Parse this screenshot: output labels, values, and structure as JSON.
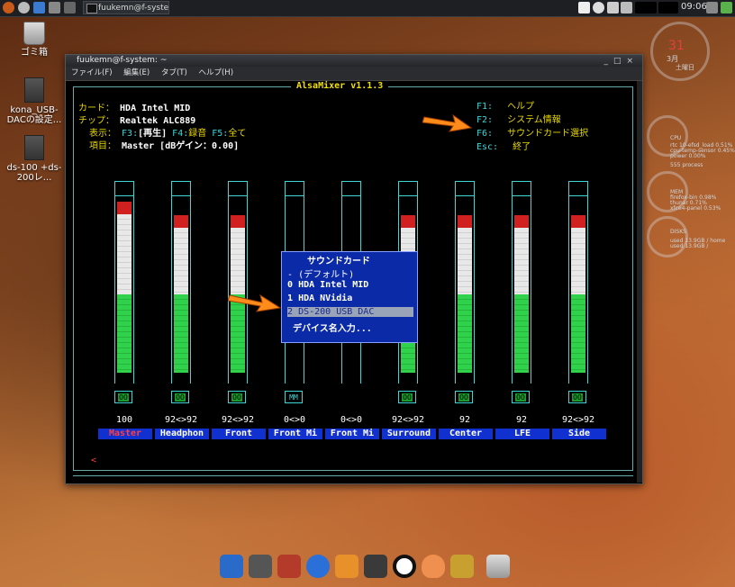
{
  "panel": {
    "task_title": "fuukemn@f-syste···",
    "clock": "09:06"
  },
  "desktop": {
    "icons": [
      {
        "label": "ゴミ箱"
      },
      {
        "label": "kona_USB-DACの設定..."
      },
      {
        "label": "ds-100 +ds-200レ..."
      }
    ]
  },
  "conky": {
    "date_num": "31",
    "date_month": "3月",
    "date_weekday": "土曜日",
    "cpu_label": "CPU",
    "cpu_line1": "rtc 10-efsd_load   0.51%",
    "cpu_line2": "cpu-temp-sensor   0.45%",
    "cpu_line3": "power                0.00%",
    "process_label": "555 process",
    "mem_label": "MEM",
    "mem_line1": "firefox-bin      0.98%",
    "mem_line2": "thunar            0.71%",
    "mem_line3": "xfce4-panel      0.53%",
    "disk_label": "DISKS",
    "disk_line1": "used 13.9GB / home",
    "disk_line2": "used  13.9GB /"
  },
  "window": {
    "title": "fuukemn@f-system: ~",
    "menu": [
      "ファイル(F)",
      "編集(E)",
      "タブ(T)",
      "ヘルプ(H)"
    ]
  },
  "mixer": {
    "app_title": "AlsaMixer v1.1.3",
    "card_label": "カード：",
    "card_value": "HDA Intel MID",
    "chip_label": "チップ：",
    "chip_value": "Realtek ALC889",
    "view_label": "表示：",
    "view_f3": "F3:",
    "view_play": "[再生]",
    "view_f4": "F4:",
    "view_rec": "録音",
    "view_f5": "F5:",
    "view_all": "全て",
    "item_label": "項目：",
    "item_value": "Master [dBゲイン：0.00]",
    "keys": [
      {
        "key": "F1:",
        "desc": "ヘルプ"
      },
      {
        "key": "F2:",
        "desc": "システム情報"
      },
      {
        "key": "F6:",
        "desc": "サウンドカード選択"
      },
      {
        "key": "Esc:",
        "desc": "終了"
      }
    ],
    "channels": [
      {
        "name": "Master",
        "value": "100",
        "switch": "OO",
        "level": 1.0
      },
      {
        "name": "Headphon",
        "value": "92<>92",
        "switch": "OO",
        "level": 0.92
      },
      {
        "name": "Front",
        "value": "92<>92",
        "switch": "OO",
        "level": 0.92
      },
      {
        "name": "Front Mi",
        "value": "0<>0",
        "switch": "MM",
        "level": 0
      },
      {
        "name": "Front Mi",
        "value": "0<>0",
        "switch": "",
        "level": 0
      },
      {
        "name": "Surround",
        "value": "92<>92",
        "switch": "OO",
        "level": 0.92
      },
      {
        "name": "Center",
        "value": "92",
        "switch": "OO",
        "level": 0.92
      },
      {
        "name": "LFE",
        "value": "92",
        "switch": "OO",
        "level": 0.92
      },
      {
        "name": "Side",
        "value": "92<>92",
        "switch": "OO",
        "level": 0.92
      }
    ],
    "selected_marker": "<",
    "popup": {
      "title": "サウンドカード",
      "items": [
        {
          "index": "-",
          "label": "(デフォルト)"
        },
        {
          "index": "0",
          "label": "HDA Intel MID"
        },
        {
          "index": "1",
          "label": "HDA NVidia"
        },
        {
          "index": "2",
          "label": "DS-200 USB DAC"
        },
        {
          "index": "",
          "label": "デバイス名入力..."
        }
      ]
    }
  },
  "dock": {
    "items": [
      "anchor-icon",
      "monitor-icon",
      "network-icon",
      "globe-icon",
      "vlc-icon",
      "media-player-icon",
      "a-app-icon",
      "peach-icon",
      "tools-icon",
      "trash-icon"
    ]
  },
  "colors": {
    "mixer_yellow": "#e8d800",
    "mixer_cyan": "#3fd6d6",
    "mixer_blue": "#1030d0",
    "bar_green": "#2fd24a",
    "bar_red": "#d02020"
  }
}
